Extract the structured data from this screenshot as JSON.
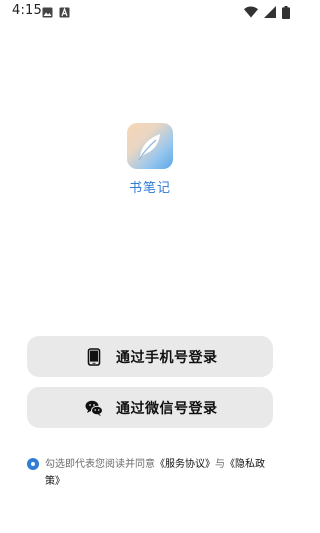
{
  "status_bar": {
    "time": "4:15",
    "left_icons": [
      "gallery-notification-icon",
      "a-notification-icon"
    ],
    "right_icons": [
      "wifi-icon",
      "signal-icon",
      "battery-icon"
    ]
  },
  "app": {
    "icon": "feather-icon",
    "name": "书笔记"
  },
  "buttons": {
    "phone": {
      "icon": "phone-icon",
      "label": "通过手机号登录"
    },
    "wechat": {
      "icon": "wechat-icon",
      "label": "通过微信号登录"
    }
  },
  "agreement": {
    "checked": true,
    "prefix": "勾选即代表您阅读并同意",
    "service_link": "《服务协议》",
    "conjunction": "与",
    "privacy_link": "《隐私政策》"
  },
  "colors": {
    "accent": "#2f7bd8",
    "button_bg": "#e9e9e9",
    "background": "#ffffff"
  }
}
